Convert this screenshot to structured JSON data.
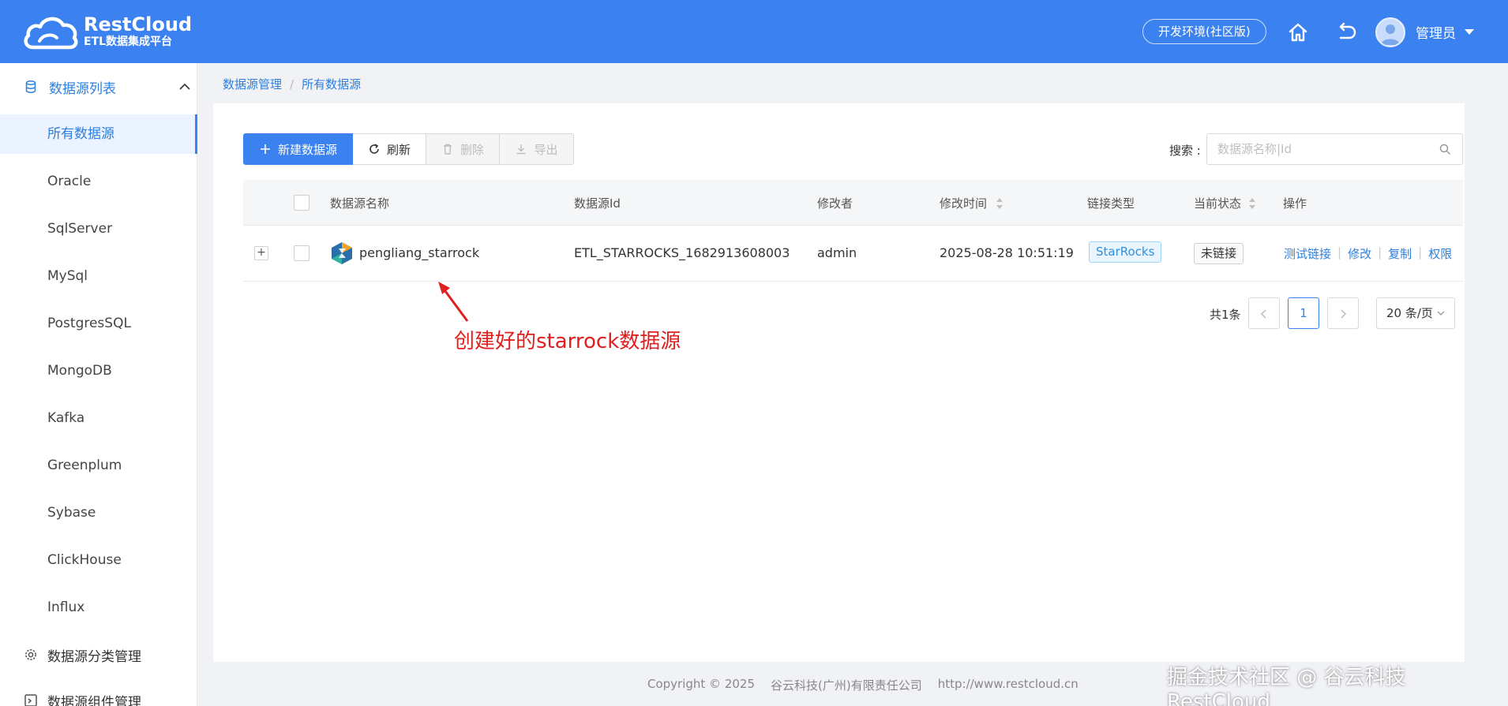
{
  "header": {
    "logo_title": "RestCloud",
    "logo_subtitle": "ETL数据集成平台",
    "env_label": "开发环境(社区版)",
    "user_name": "管理员",
    "bg_color": "#3b82f0"
  },
  "sidebar": {
    "group_datasource": "数据源列表",
    "items": [
      {
        "label": "所有数据源"
      },
      {
        "label": "Oracle"
      },
      {
        "label": "SqlServer"
      },
      {
        "label": "MySql"
      },
      {
        "label": "PostgresSQL"
      },
      {
        "label": "MongoDB"
      },
      {
        "label": "Kafka"
      },
      {
        "label": "Greenplum"
      },
      {
        "label": "Sybase"
      },
      {
        "label": "ClickHouse"
      },
      {
        "label": "Influx"
      }
    ],
    "group_category": "数据源分类管理",
    "group_component": "数据源组件管理"
  },
  "breadcrumb": {
    "level1": "数据源管理",
    "sep": "/",
    "level2": "所有数据源"
  },
  "toolbar": {
    "new_label": "新建数据源",
    "refresh_label": "刷新",
    "delete_label": "删除",
    "export_label": "导出"
  },
  "search": {
    "label": "搜索 :",
    "placeholder": "数据源名称|Id"
  },
  "table": {
    "columns": {
      "name": "数据源名称",
      "id": "数据源Id",
      "modifier": "修改者",
      "time": "修改时间",
      "type": "链接类型",
      "status": "当前状态",
      "ops": "操作"
    },
    "rows": [
      {
        "expand": "+",
        "name": "pengliang_starrock",
        "id": "ETL_STARROCKS_1682913608003",
        "modifier": "admin",
        "time": "2025-08-28 10:51:19",
        "type": "StarRocks",
        "status": "未链接",
        "op_test": "测试链接",
        "op_edit": "修改",
        "op_copy": "复制",
        "op_perm": "权限"
      }
    ]
  },
  "pagination": {
    "total": "共1条",
    "current_page": "1",
    "page_size": "20 条/页"
  },
  "annotation": {
    "text": "创建好的starrock数据源",
    "color": "#e0201e"
  },
  "footer": {
    "copyright": "Copyright © 2025",
    "company": "谷云科技(广州)有限责任公司",
    "url": "http://www.restcloud.cn"
  },
  "watermark": "掘金技术社区 @ 谷云科技RestCloud"
}
